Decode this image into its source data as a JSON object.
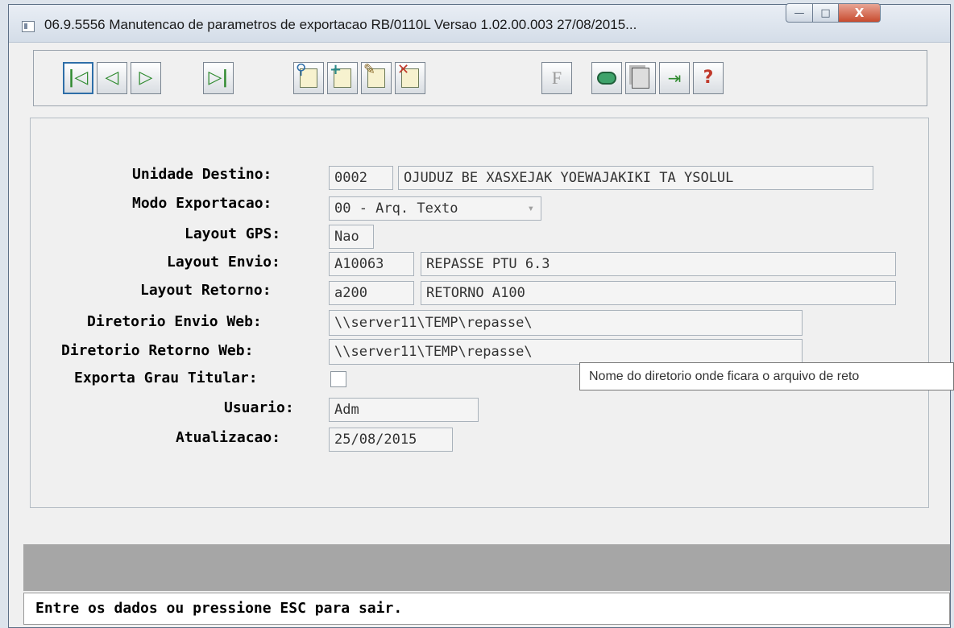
{
  "window": {
    "title": "06.9.5556 Manutencao  de parametros de exportacao RB/0110L Versao 1.02.00.003 27/08/2015...",
    "controls": {
      "minimize": "—",
      "maximize": "□",
      "close": "X"
    }
  },
  "toolbar": {
    "buttons": [
      {
        "name": "first-record",
        "icon": "first-icon",
        "glyph": "|◁"
      },
      {
        "name": "previous-record",
        "icon": "previous-icon",
        "glyph": "◁"
      },
      {
        "name": "next-record",
        "icon": "next-icon",
        "glyph": "▷"
      },
      {
        "name": "last-record",
        "icon": "last-icon",
        "glyph": "▷|"
      },
      {
        "name": "search",
        "icon": "magnifier-icon"
      },
      {
        "name": "add",
        "icon": "plus-icon"
      },
      {
        "name": "edit",
        "icon": "pencil-icon"
      },
      {
        "name": "delete",
        "icon": "x-icon"
      },
      {
        "name": "filter",
        "icon": "f-icon",
        "glyph": "F"
      },
      {
        "name": "print",
        "icon": "printer-icon"
      },
      {
        "name": "copy",
        "icon": "copy-icon"
      },
      {
        "name": "exit",
        "icon": "exit-door-icon"
      },
      {
        "name": "help",
        "icon": "help-icon",
        "glyph": "?"
      }
    ]
  },
  "form": {
    "unidade_destino": {
      "label": "Unidade Destino:",
      "code": "0002",
      "name": "OJUDUZ BE XASXEJAK YOEWAJAKIKI TA YSOLUL"
    },
    "modo_exportacao": {
      "label": "Modo Exportacao:",
      "value": "00 - Arq. Texto",
      "arrow": "▾"
    },
    "layout_gps": {
      "label": "Layout GPS:",
      "value": "Nao"
    },
    "layout_envio": {
      "label": "Layout Envio:",
      "code": "A10063",
      "description": "REPASSE PTU 6.3"
    },
    "layout_retorno": {
      "label": "Layout Retorno:",
      "code": "a200",
      "description": "RETORNO A100"
    },
    "diretorio_envio_web": {
      "label": "Diretorio Envio Web:",
      "value": "\\\\server11\\TEMP\\repasse\\"
    },
    "diretorio_retorno_web": {
      "label": "Diretorio Retorno Web:",
      "value": "\\\\server11\\TEMP\\repasse\\"
    },
    "exporta_grau_titular": {
      "label": "Exporta Grau Titular:",
      "checked": false
    },
    "usuario": {
      "label": "Usuario:",
      "value": "Adm"
    },
    "atualizacao": {
      "label": "Atualizacao:",
      "value": "25/08/2015"
    }
  },
  "tooltip": {
    "text": "Nome do diretorio onde ficara o arquivo de reto"
  },
  "status_bar": {
    "text": "Entre os dados ou pressione ESC para sair."
  },
  "colors": {
    "nav_green": "#2f8a2f",
    "accent_blue": "#2e6ea8",
    "doc_yellow": "#f7f2cf",
    "status_gray": "#a6a6a6"
  }
}
